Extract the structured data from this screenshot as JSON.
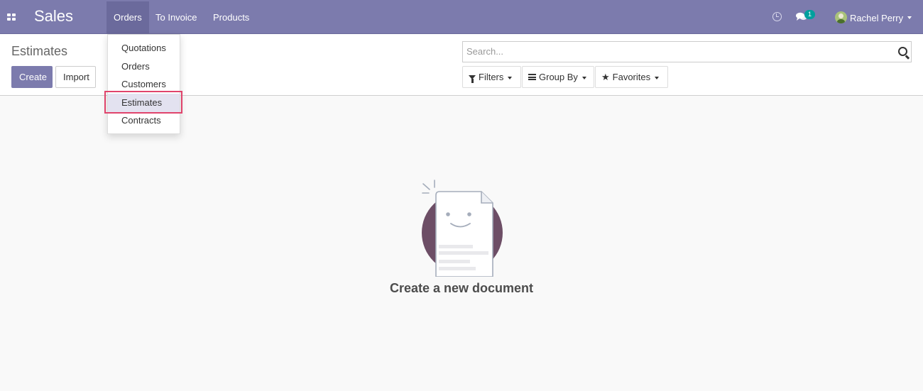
{
  "navbar": {
    "app_name": "Sales",
    "menus": [
      {
        "label": "Orders",
        "active": true
      },
      {
        "label": "To Invoice",
        "active": false
      },
      {
        "label": "Products",
        "active": false
      }
    ],
    "chat_badge": "1",
    "user_name": "Rachel Perry"
  },
  "control_panel": {
    "title": "Estimates",
    "create_label": "Create",
    "import_label": "Import",
    "search_placeholder": "Search...",
    "filters_label": "Filters",
    "group_by_label": "Group By",
    "favorites_label": "Favorites"
  },
  "orders_dropdown": {
    "items": [
      "Quotations",
      "Orders",
      "Customers",
      "Estimates",
      "Contracts"
    ],
    "selected": "Estimates"
  },
  "empty_state": {
    "message": "Create a new document"
  },
  "colors": {
    "navbar": "#7c7bad",
    "primary_button": "#7c7bad",
    "highlight_border": "#e0446c",
    "badge": "#00a09d",
    "illustration_circle": "#6d4e66"
  }
}
